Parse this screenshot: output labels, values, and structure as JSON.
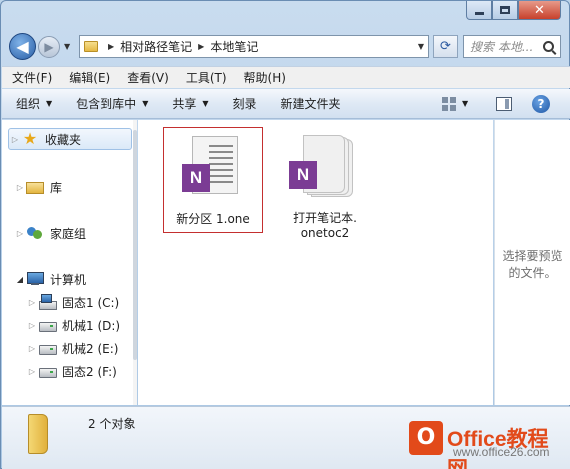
{
  "window": {
    "caption_close": "✕"
  },
  "address_bar": {
    "crumbs": [
      "相对路径笔记",
      "本地笔记"
    ],
    "search_placeholder": "搜索 本地..."
  },
  "menu": [
    "文件(F)",
    "编辑(E)",
    "查看(V)",
    "工具(T)",
    "帮助(H)"
  ],
  "toolbar": {
    "organize": "组织",
    "include_in_library": "包含到库中",
    "share": "共享",
    "burn": "刻录",
    "new_folder": "新建文件夹",
    "help": "?"
  },
  "nav_pane": {
    "favorites": "收藏夹",
    "libraries": "库",
    "homegroup": "家庭组",
    "computer": "计算机",
    "drives": [
      "固态1 (C:)",
      "机械1 (D:)",
      "机械2 (E:)",
      "固态2 (F:)"
    ]
  },
  "files": [
    {
      "name": "新分区 1.one",
      "type": "onenote-section",
      "selected": true
    },
    {
      "name_line1": "打开笔记本.",
      "name_line2": "onetoc2",
      "type": "onenote-toc",
      "selected": false
    }
  ],
  "onenote_badge": "N",
  "preview_pane": {
    "line1": "选择要预览",
    "line2": "的文件。"
  },
  "details": {
    "count": "2 个对象"
  },
  "watermark": {
    "logo": "O",
    "brand": "Office教程网",
    "url": "www.office26.com"
  }
}
